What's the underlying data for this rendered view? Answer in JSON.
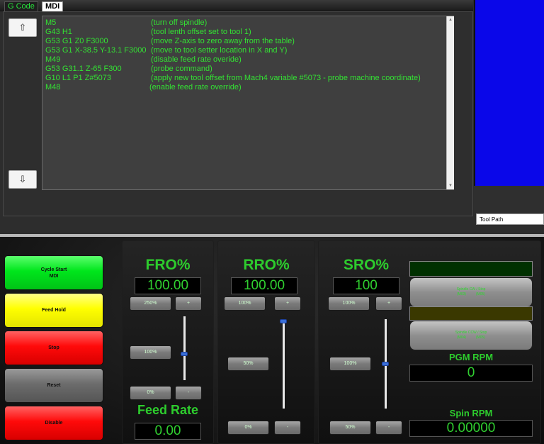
{
  "tabs": {
    "gcode": "G Code",
    "mdi": "MDI"
  },
  "nav": {
    "up": "⇧",
    "down": "⇩"
  },
  "mdi_lines": [
    {
      "code": "M5",
      "comment": "(turn off spindle)"
    },
    {
      "code": "G43 H1",
      "comment": "(tool lenth offset set to tool 1)"
    },
    {
      "code": "G53 G1 Z0 F3000",
      "comment": "(move Z-axis to zero away from the table)"
    },
    {
      "code": "G53 G1 X-38.5 Y-13.1 F3000",
      "comment": "(move to tool setter location in X and Y)"
    },
    {
      "code": "M49",
      "comment": "(disable feed rate overide)"
    },
    {
      "code": "G53 G31.1 Z-65 F300",
      "comment": "(probe command)"
    },
    {
      "code": "G10 L1 P1 Z#5073",
      "comment": "(apply new tool offset from Mach4 variable #5073 - probe machine coordinate)"
    },
    {
      "code": "M48",
      "comment": "(enable feed rate override)"
    }
  ],
  "toolpath_tab": "Tool Path",
  "controls": {
    "cycle_start": "Cycle Start",
    "cycle_start_sub": "MDI",
    "feed_hold": "Feed Hold",
    "stop": "Stop",
    "reset": "Reset",
    "disable": "Disable"
  },
  "fro": {
    "title": "FRO%",
    "value": "100.00",
    "max_btn": "250%",
    "plus": "+",
    "mid_btn": "100%",
    "min_btn": "0%",
    "minus": "-",
    "slider_level": 0.4
  },
  "feed_rate": {
    "title": "Feed Rate",
    "value": "0.00"
  },
  "rro": {
    "title": "RRO%",
    "value": "100.00",
    "max_btn": "100%",
    "plus": "+",
    "mid_btn": "50%",
    "min_btn": "0%",
    "minus": "-",
    "slider_level": 1.0
  },
  "sro": {
    "title": "SRO%",
    "value": "100",
    "max_btn": "100%",
    "plus": "+",
    "mid_btn": "100%",
    "min_btn": "50%",
    "minus": "-",
    "slider_level": 0.5
  },
  "spindle": {
    "cw_label": "Spindle CW / Stop",
    "cw_codes": "(M03)          (M05)",
    "ccw_label": "Spindle CCW / Stop",
    "ccw_codes": "(M04)          (M05)"
  },
  "pgm_rpm": {
    "label": "PGM RPM",
    "value": "0"
  },
  "spin_rpm": {
    "label": "Spin RPM",
    "value": "0.00000"
  },
  "colors": {
    "green_text": "#33e233",
    "blue_view": "#0a07e9",
    "slider_thumb": "#3a6fd8"
  }
}
